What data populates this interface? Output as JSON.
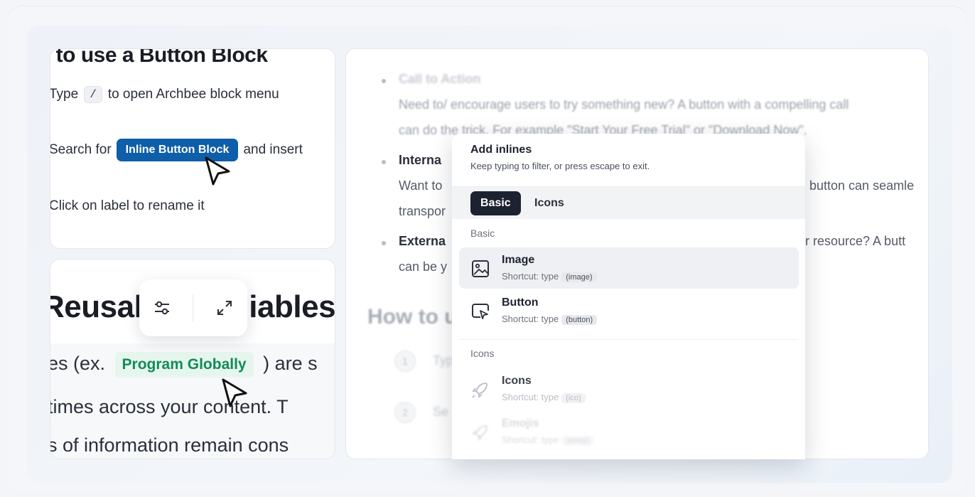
{
  "left_top": {
    "heading": "/ to use a Button Block",
    "step1_before": "Type",
    "step1_key": "/",
    "step1_after": "to open Archbee block menu",
    "step2_before": "Search for",
    "step2_pill": "Inline Button Block",
    "step2_after": "and insert",
    "step3": "Click on label to rename it"
  },
  "left_bottom": {
    "heading_left": "Reusal",
    "heading_right": "iables",
    "line1_before": "es (ex.",
    "line1_pill": "Program Globally",
    "line1_after": ") are s",
    "line2": "times across your content. T",
    "line3": "s of information remain cons"
  },
  "right_bg": {
    "top_line": "",
    "cta_label": "Call to Action",
    "cta_line1": "Need to/ encourage users to try something new? A button with a compelling call",
    "cta_line2": "can do the trick. For example \"Start Your Free Trial\" or \"Download Now\".",
    "internal_label": "Interna",
    "internal_line1": "Want to",
    "internal_line1_right": "button can seamle",
    "internal_line2": "transpor",
    "external_label": "Externa",
    "external_right": "r resource? A butt",
    "external_line2": "can be y",
    "how_to": "How to u",
    "step1_num": "1",
    "step1_text": "Typ",
    "step2_num": "2",
    "step2_text": "Se"
  },
  "popover": {
    "title": "Add inlines",
    "subtitle": "Keep typing to filter, or press escape to exit.",
    "tabs": [
      "Basic",
      "Icons"
    ],
    "section_basic": "Basic",
    "section_icons": "Icons",
    "items": [
      {
        "name": "Image",
        "hint": "Shortcut: type",
        "chip": "(image)"
      },
      {
        "name": "Button",
        "hint": "Shortcut: type",
        "chip": "(button)"
      },
      {
        "name": "Icons",
        "hint": "Shortcut: type",
        "chip": "(ico)"
      },
      {
        "name": "Emojis",
        "hint": "Shortcut: type",
        "chip": "(emoji)"
      }
    ]
  },
  "icons": {
    "floatbar": [
      "sliders-icon",
      "expand-icon"
    ],
    "items": [
      "image-icon",
      "button-icon",
      "rocket-icon",
      "rocket-icon"
    ]
  },
  "colors": {
    "accent_blue": "#0e5ea9",
    "accent_green": "#138a5a",
    "dark_tab": "#1d2230"
  }
}
